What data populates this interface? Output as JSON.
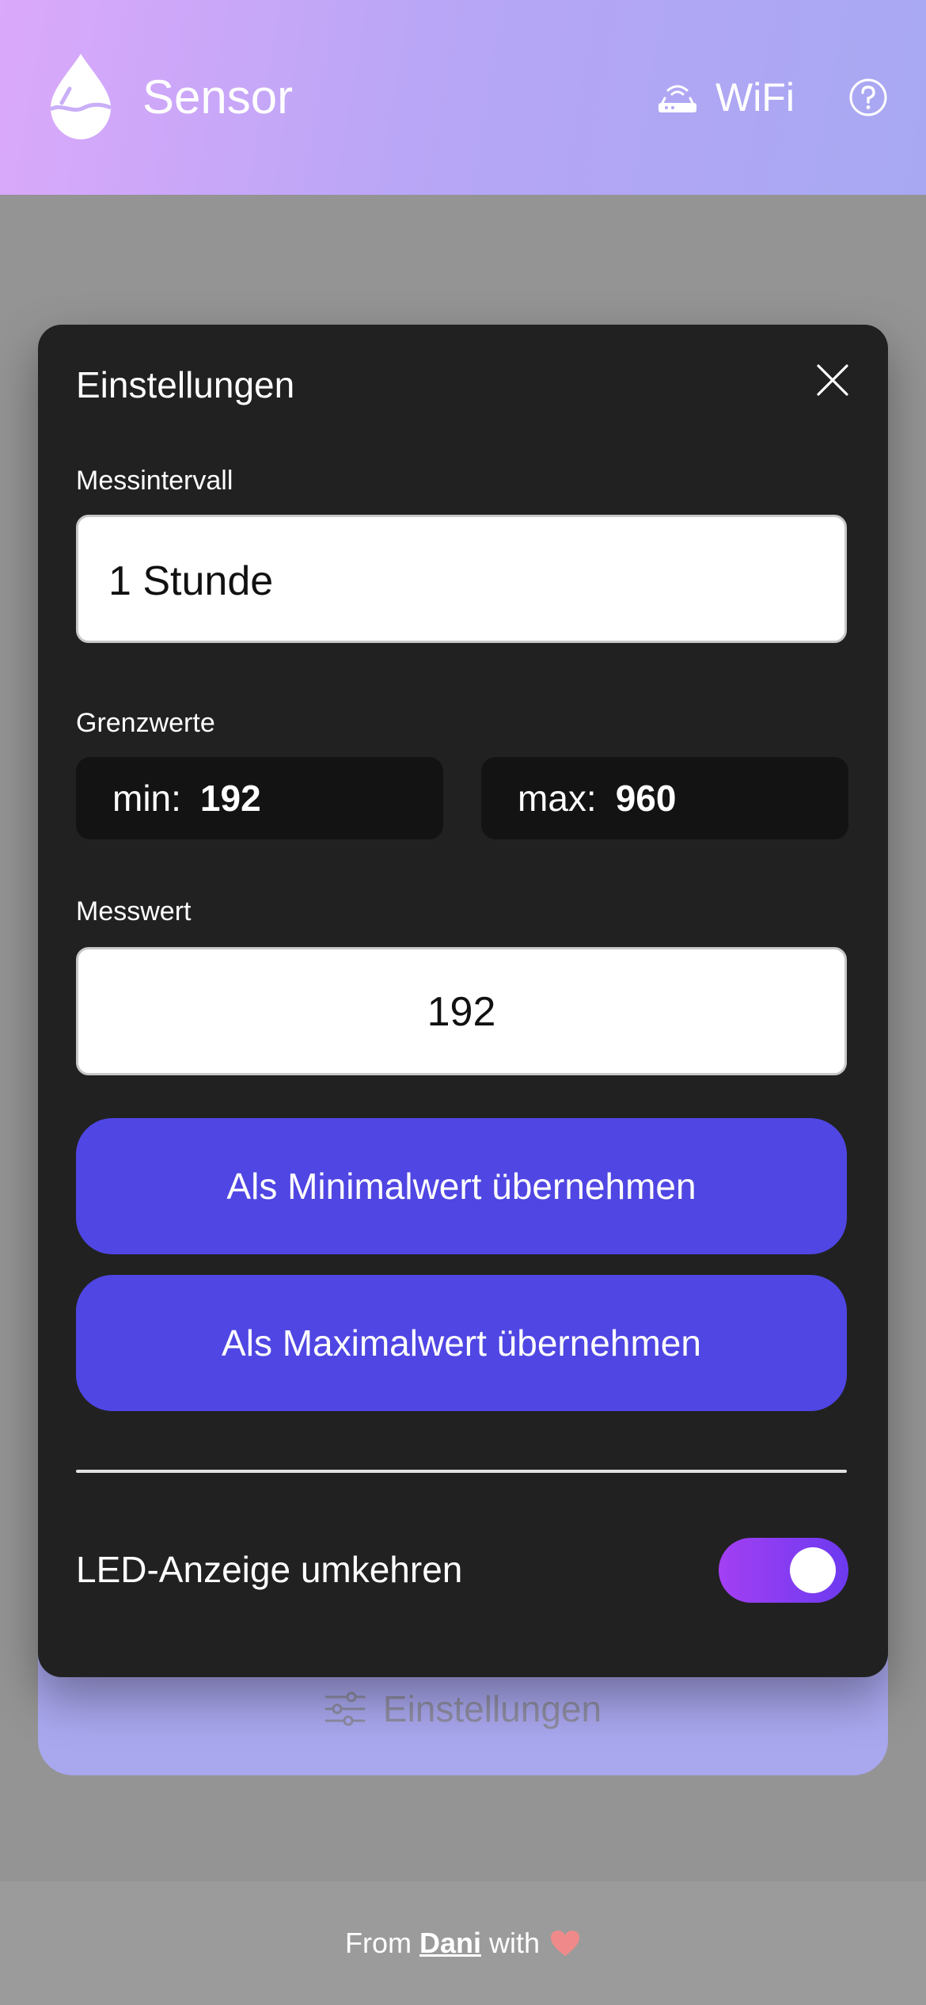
{
  "header": {
    "title": "Sensor",
    "wifi_label": "WiFi"
  },
  "background": {
    "settings_button_label": "Einstellungen"
  },
  "modal": {
    "title": "Einstellungen",
    "interval": {
      "label": "Messintervall",
      "value": "1 Stunde"
    },
    "thresholds": {
      "label": "Grenzwerte",
      "min_label": "min:",
      "min_value": "192",
      "max_label": "max:",
      "max_value": "960"
    },
    "measurement": {
      "label": "Messwert",
      "value": "192"
    },
    "set_min_button": "Als Minimalwert übernehmen",
    "set_max_button": "Als Maximalwert übernehmen",
    "led_invert": {
      "label": "LED-Anzeige umkehren",
      "enabled": true
    }
  },
  "footer": {
    "prefix": "From",
    "author": "Dani",
    "suffix": "with"
  },
  "colors": {
    "accent": "#4f46e3",
    "toggle_gradient_start": "#a33ff3",
    "toggle_gradient_end": "#6c3af0",
    "modal_bg": "#212121",
    "heart": "#f08a8a"
  }
}
